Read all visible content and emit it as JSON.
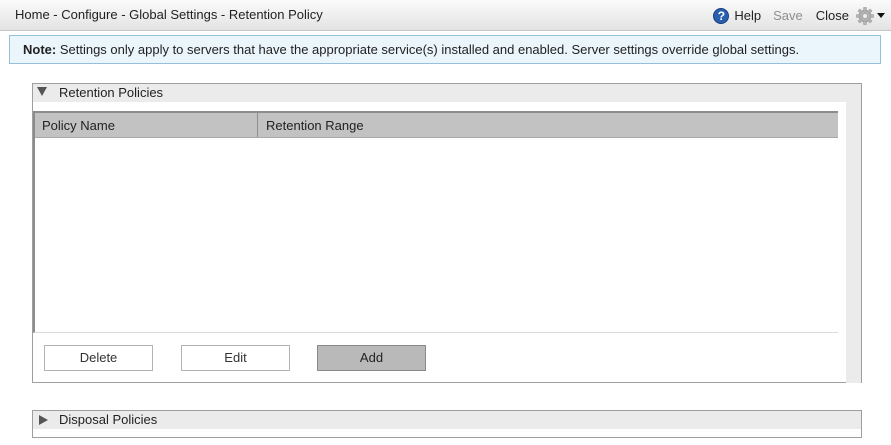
{
  "header": {
    "breadcrumb": "Home - Configure - Global Settings - Retention Policy",
    "help_label": "Help",
    "save_label": "Save",
    "close_label": "Close",
    "icons": [
      "help-icon",
      "gear-icon",
      "dropdown-arrow-icon"
    ]
  },
  "note": {
    "label": "Note:",
    "text": " Settings only apply to servers that have the appropriate service(s) installed and enabled. Server settings override global settings."
  },
  "retention_panel": {
    "title": "Retention Policies",
    "expanded": true,
    "table": {
      "columns": [
        "Policy Name",
        "Retention Range"
      ],
      "rows": []
    },
    "buttons": {
      "delete_label": "Delete",
      "edit_label": "Edit",
      "add_label": "Add"
    }
  },
  "disposal_panel": {
    "title": "Disposal Policies",
    "expanded": false
  },
  "colors": {
    "note_background": "#ebf5fc",
    "note_border": "#96bfd9",
    "table_header": "#c2c2c2",
    "primary_button": "#b9b9b9"
  }
}
